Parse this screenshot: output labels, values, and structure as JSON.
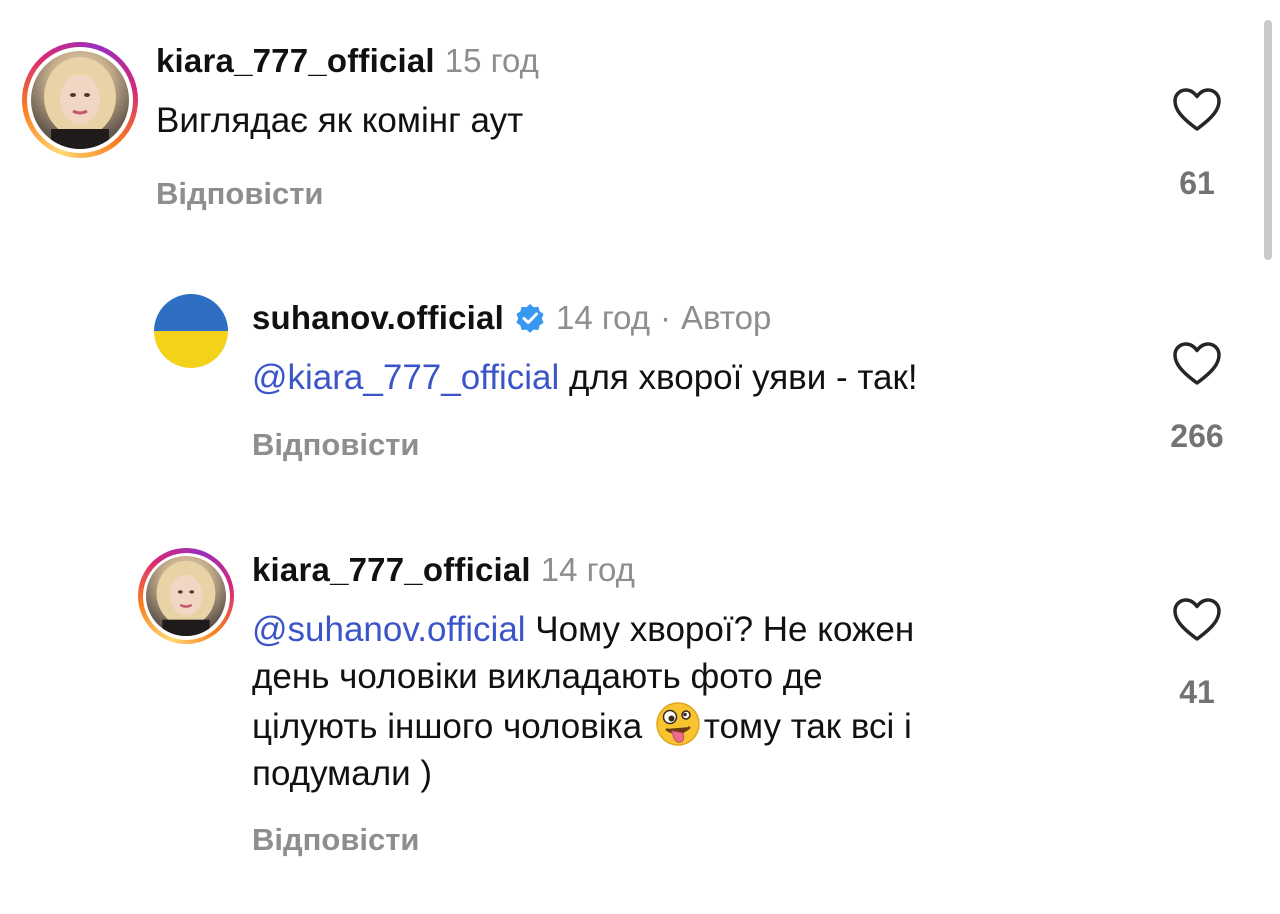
{
  "comments": [
    {
      "username": "kiara_777_official",
      "time": "15 год",
      "text": "Виглядає як комінг аут",
      "reply_label": "Відповісти",
      "likes": "61"
    },
    {
      "username": "suhanov.official",
      "verified": true,
      "time": "14 год",
      "author_tag": "Автор",
      "mention": "@kiara_777_official",
      "text": "для хворої уяви - так!",
      "reply_label": "Відповісти",
      "likes": "266"
    },
    {
      "username": "kiara_777_official",
      "time": "14 год",
      "mention": "@suhanov.official",
      "text_line1": " Чому хворої? Не кожен",
      "text_line2": "день чоловіки викладають фото де",
      "text_line3a": "цілують іншого чоловіка ",
      "emoji": "zany-face",
      "text_line3b": "тому так всі і",
      "text_line4": "подумали )",
      "reply_label": "Відповісти",
      "likes": "41"
    }
  ],
  "colors": {
    "mention": "#3b55c9",
    "meta": "#8e8e8e",
    "verified": "#3897f0"
  }
}
